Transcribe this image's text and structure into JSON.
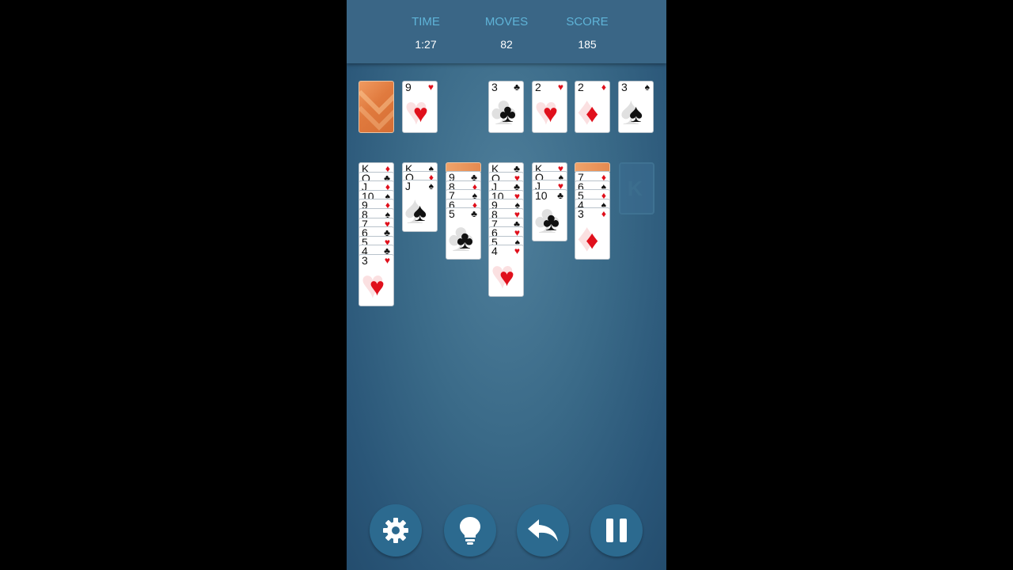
{
  "stats": {
    "time_label": "TIME",
    "time": "1:27",
    "moves_label": "MOVES",
    "moves": "82",
    "score_label": "SCORE",
    "score": "185"
  },
  "waste": {
    "rank": "9",
    "suit": "♥",
    "color": "red"
  },
  "foundations": [
    {
      "rank": "3",
      "suit": "♣",
      "color": "black"
    },
    {
      "rank": "2",
      "suit": "♥",
      "color": "red"
    },
    {
      "rank": "2",
      "suit": "♦",
      "color": "red"
    },
    {
      "rank": "3",
      "suit": "♠",
      "color": "black"
    }
  ],
  "empty_column_label": "K",
  "tableau": [
    {
      "hidden": 0,
      "cards": [
        {
          "rank": "K",
          "suit": "♦",
          "color": "red"
        },
        {
          "rank": "Q",
          "suit": "♣",
          "color": "black"
        },
        {
          "rank": "J",
          "suit": "♦",
          "color": "red"
        },
        {
          "rank": "10",
          "suit": "♠",
          "color": "black"
        },
        {
          "rank": "9",
          "suit": "♦",
          "color": "red"
        },
        {
          "rank": "8",
          "suit": "♠",
          "color": "black"
        },
        {
          "rank": "7",
          "suit": "♥",
          "color": "red"
        },
        {
          "rank": "6",
          "suit": "♣",
          "color": "black"
        },
        {
          "rank": "5",
          "suit": "♥",
          "color": "red"
        },
        {
          "rank": "4",
          "suit": "♣",
          "color": "black"
        },
        {
          "rank": "3",
          "suit": "♥",
          "color": "red"
        }
      ]
    },
    {
      "hidden": 0,
      "cards": [
        {
          "rank": "K",
          "suit": "♠",
          "color": "black"
        },
        {
          "rank": "Q",
          "suit": "♦",
          "color": "red"
        },
        {
          "rank": "J",
          "suit": "♠",
          "color": "black"
        }
      ]
    },
    {
      "hidden": 1,
      "cards": [
        {
          "rank": "9",
          "suit": "♣",
          "color": "black"
        },
        {
          "rank": "8",
          "suit": "♦",
          "color": "red"
        },
        {
          "rank": "7",
          "suit": "♠",
          "color": "black"
        },
        {
          "rank": "6",
          "suit": "♦",
          "color": "red"
        },
        {
          "rank": "5",
          "suit": "♣",
          "color": "black"
        }
      ]
    },
    {
      "hidden": 0,
      "cards": [
        {
          "rank": "K",
          "suit": "♣",
          "color": "black"
        },
        {
          "rank": "Q",
          "suit": "♥",
          "color": "red"
        },
        {
          "rank": "J",
          "suit": "♣",
          "color": "black"
        },
        {
          "rank": "10",
          "suit": "♥",
          "color": "red"
        },
        {
          "rank": "9",
          "suit": "♠",
          "color": "black"
        },
        {
          "rank": "8",
          "suit": "♥",
          "color": "red"
        },
        {
          "rank": "7",
          "suit": "♣",
          "color": "black"
        },
        {
          "rank": "6",
          "suit": "♥",
          "color": "red"
        },
        {
          "rank": "5",
          "suit": "♠",
          "color": "black"
        },
        {
          "rank": "4",
          "suit": "♥",
          "color": "red"
        }
      ]
    },
    {
      "hidden": 0,
      "cards": [
        {
          "rank": "K",
          "suit": "♥",
          "color": "red"
        },
        {
          "rank": "Q",
          "suit": "♠",
          "color": "black"
        },
        {
          "rank": "J",
          "suit": "♥",
          "color": "red"
        },
        {
          "rank": "10",
          "suit": "♣",
          "color": "black"
        }
      ]
    },
    {
      "hidden": 1,
      "cards": [
        {
          "rank": "7",
          "suit": "♦",
          "color": "red"
        },
        {
          "rank": "6",
          "suit": "♠",
          "color": "black"
        },
        {
          "rank": "5",
          "suit": "♦",
          "color": "red"
        },
        {
          "rank": "4",
          "suit": "♠",
          "color": "black"
        },
        {
          "rank": "3",
          "suit": "♦",
          "color": "red"
        }
      ]
    }
  ],
  "buttons": [
    {
      "name": "settings-button",
      "icon": "gear-icon"
    },
    {
      "name": "hint-button",
      "icon": "lightbulb-icon"
    },
    {
      "name": "undo-button",
      "icon": "undo-arrow-icon"
    },
    {
      "name": "pause-button",
      "icon": "pause-icon"
    }
  ],
  "colors": {
    "red_suit": "#e0101c",
    "black_suit": "#111111",
    "button": "#2c6a8f",
    "label": "#5fb4d8"
  }
}
